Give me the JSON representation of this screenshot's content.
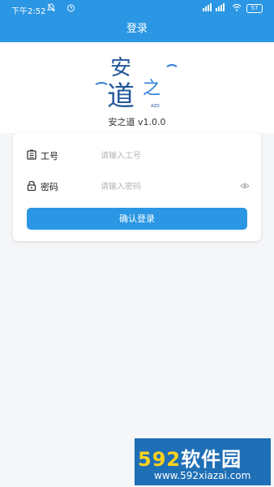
{
  "status_bar": {
    "time": "下午2:52",
    "battery": "57"
  },
  "app_bar": {
    "title": "登录"
  },
  "brand": {
    "logo_text": "安之道",
    "logo_small": "AZD",
    "version": "安之道 v1.0.0"
  },
  "form": {
    "employee_id": {
      "label": "工号",
      "placeholder": "请输入工号"
    },
    "password": {
      "label": "密码",
      "placeholder": "请输入密码"
    },
    "submit_label": "确认登录"
  },
  "watermark": {
    "big": "592软件园",
    "big_num": "592",
    "big_rest": "软件园",
    "small": "www.592xiazai.com"
  },
  "colors": {
    "primary": "#2b96e3"
  },
  "icons": [
    "mute-bell-icon",
    "alarm-icon",
    "signal-icon",
    "wifi-icon",
    "battery-icon",
    "id-card-icon",
    "lock-icon",
    "eye-icon"
  ]
}
